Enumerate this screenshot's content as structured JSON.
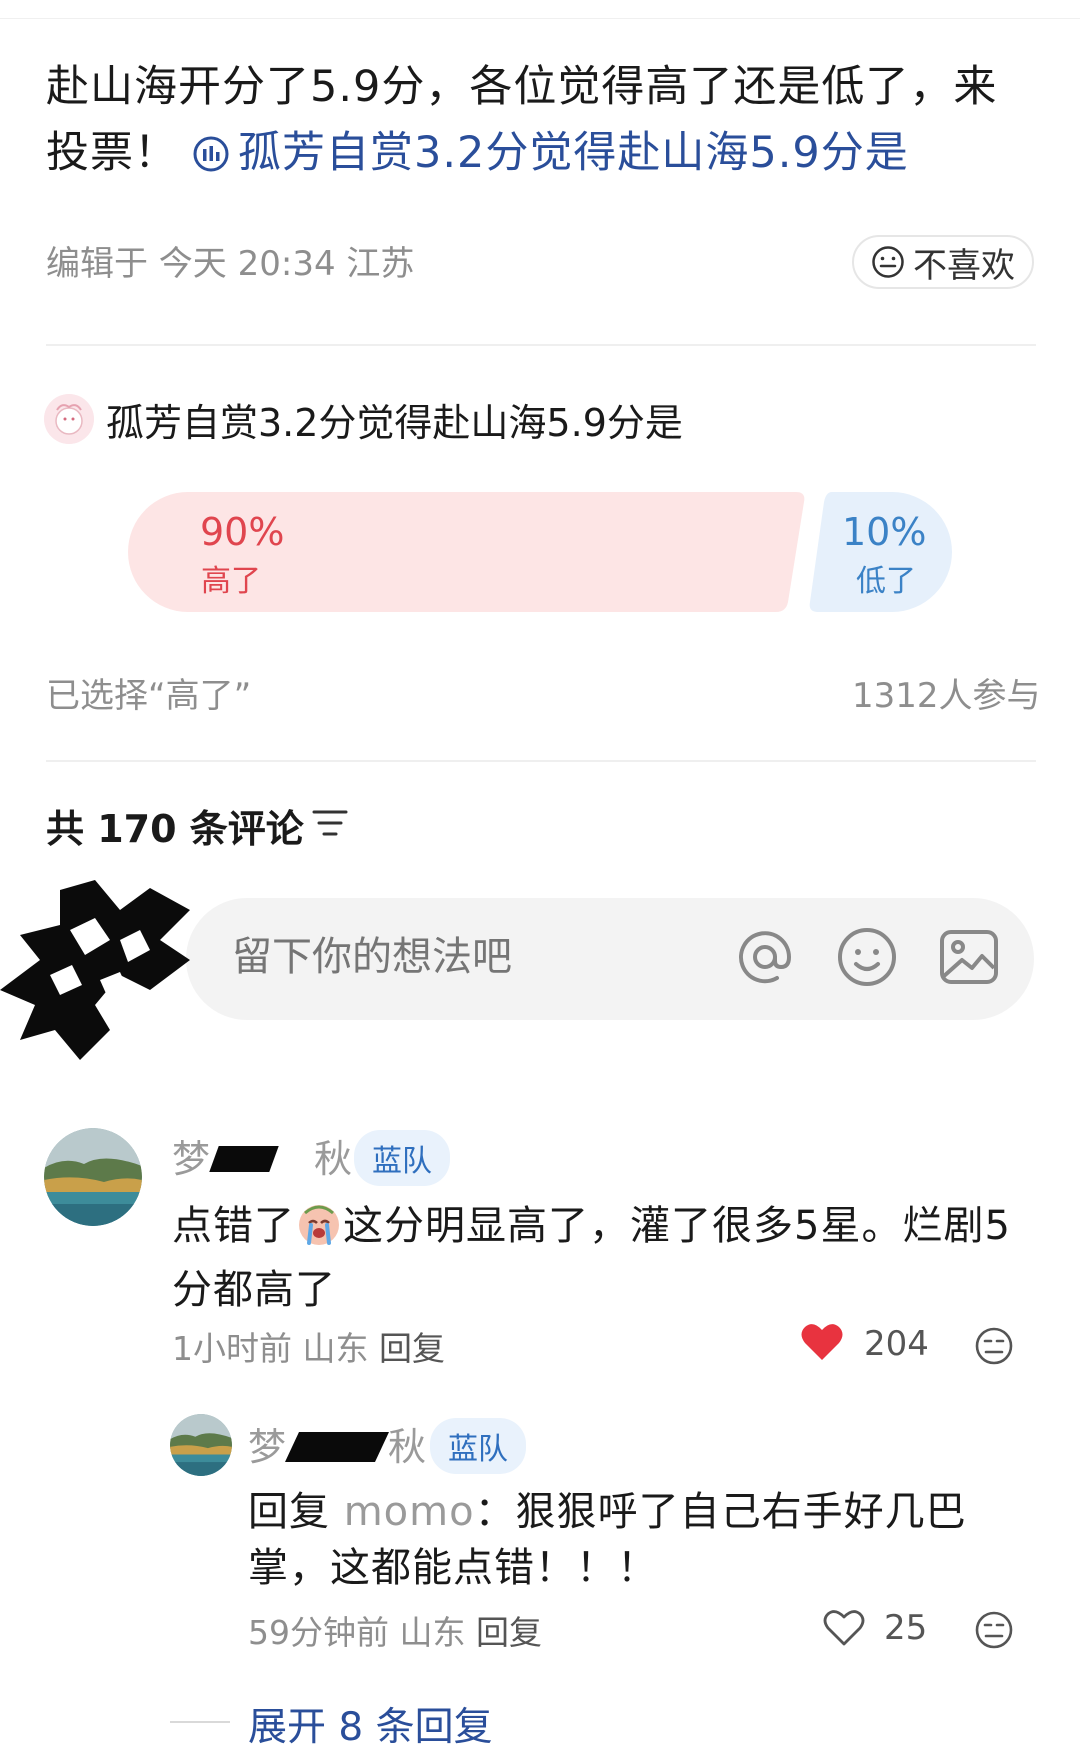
{
  "post": {
    "text": "赴山海开分了5.9分，各位觉得高了还是低了，来投票！",
    "poll_link": "孤芳自赏3.2分觉得赴山海5.9分是",
    "edited_meta": "编辑于 今天 20:34 江苏",
    "dislike_label": "不喜欢"
  },
  "poll": {
    "title": "孤芳自赏3.2分觉得赴山海5.9分是",
    "options": [
      {
        "percent": "90%",
        "label": "高了",
        "value": 0.9,
        "color": "#e0454e"
      },
      {
        "percent": "10%",
        "label": "低了",
        "value": 0.1,
        "color": "#3b82c6"
      }
    ],
    "selected_text": "已选择“高了”",
    "participants": "1312人参与"
  },
  "comments_section": {
    "count_label": "共 170 条评论",
    "input_placeholder": "留下你的想法吧",
    "icons": [
      "at-icon",
      "emoji-icon",
      "image-icon"
    ]
  },
  "comments": [
    {
      "name_prefix": "梦",
      "name_suffix": "秋",
      "badge": "蓝队",
      "text_1": "点错了",
      "text_2": "这分明显高了，灌了很多5星。烂剧5分都高了",
      "time": "1小时前",
      "location": "山东",
      "reply_label": "回复",
      "likes": "204",
      "liked": true
    },
    {
      "name_prefix": "梦",
      "name_suffix": "秋",
      "badge": "蓝队",
      "reply_prefix": "回复",
      "reply_to": "momo",
      "text": "：狠狠呼了自己右手好几巴掌，这都能点错！！！",
      "time": "59分钟前",
      "location": "山东",
      "reply_label": "回复",
      "likes": "25",
      "liked": false
    }
  ],
  "expand_replies": "展开 8 条回复",
  "colors": {
    "link": "#2a4e9a",
    "like_red": "#e8333f",
    "badge_blue": "#2f6fbe",
    "poll_high_bg": "#fde5e5",
    "poll_low_bg": "#e6f0fb"
  }
}
